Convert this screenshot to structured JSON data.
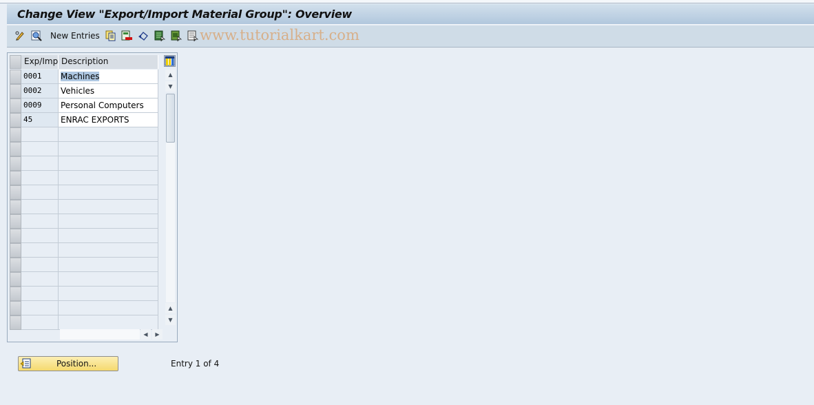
{
  "window": {
    "title": "Change View \"Export/Import Material Group\": Overview"
  },
  "toolbar": {
    "items": [
      {
        "name": "display-change-icon",
        "tooltip": ""
      },
      {
        "name": "details-icon",
        "tooltip": ""
      },
      {
        "name": "new-entries-button",
        "label": "New Entries"
      },
      {
        "name": "copy-as-icon"
      },
      {
        "name": "delete-icon"
      },
      {
        "name": "undo-change-icon"
      },
      {
        "name": "select-all-icon"
      },
      {
        "name": "select-block-icon"
      },
      {
        "name": "deselect-all-icon"
      }
    ],
    "new_entries_label": "New Entries",
    "watermark": "www.tutorialkart.com"
  },
  "table": {
    "columns": [
      "Exp/Imp",
      "Description"
    ],
    "rows": [
      {
        "key": "0001",
        "description": "Machines",
        "selected_text": true
      },
      {
        "key": "0002",
        "description": "Vehicles"
      },
      {
        "key": "0009",
        "description": "Personal Computers"
      },
      {
        "key": "45",
        "description": "ENRAC EXPORTS"
      }
    ],
    "empty_rows": 14
  },
  "footer": {
    "position_button_label": "Position...",
    "entry_info": "Entry 1 of 4"
  },
  "colors": {
    "title_gradient_top": "#d2e0ec",
    "title_gradient_bottom": "#b1c7dd",
    "toolbar_bg": "#cfdce7",
    "page_bg": "#e8eef5",
    "button_yellow": "#f5d96e",
    "selection": "#aec7e1"
  }
}
